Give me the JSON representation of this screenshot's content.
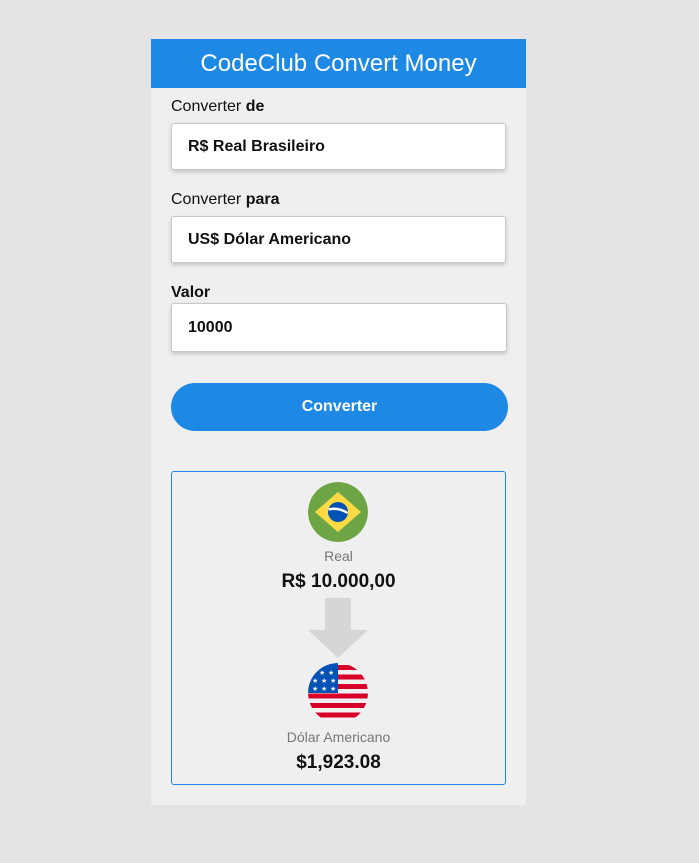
{
  "header": {
    "title": "CodeClub Convert Money"
  },
  "from": {
    "label_prefix": "Converter ",
    "label_bold": "de",
    "selected": "R$ Real Brasileiro"
  },
  "to": {
    "label_prefix": "Converter ",
    "label_bold": "para",
    "selected": "US$ Dólar Americano"
  },
  "amount": {
    "label": "Valor",
    "value": "10000"
  },
  "convert_button": {
    "label": "Converter"
  },
  "result": {
    "source": {
      "name": "Real",
      "value": "R$ 10.000,00",
      "icon": "brazil-flag-icon"
    },
    "arrow_icon": "arrow-down-icon",
    "target": {
      "name": "Dólar Americano",
      "value": "$1,923.08",
      "icon": "usa-flag-icon"
    }
  },
  "colors": {
    "accent": "#1e88e5",
    "panel": "#efefef",
    "background": "#e4e4e4"
  }
}
